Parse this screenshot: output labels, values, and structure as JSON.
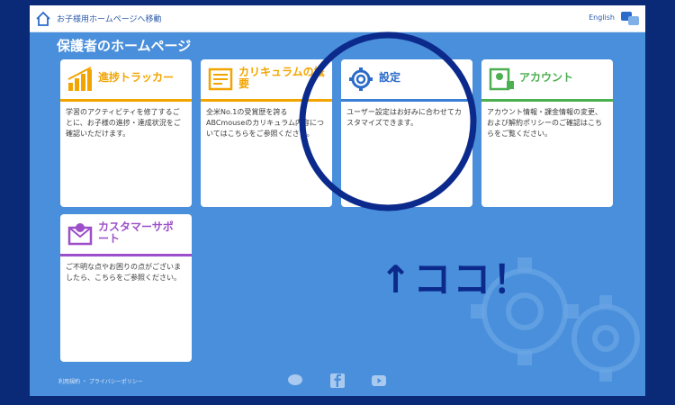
{
  "header": {
    "home_link": "お子様用ホームページへ移動",
    "language": "English"
  },
  "page_title": "保護者のホームページ",
  "cards": [
    {
      "title": "進捗トラッカー",
      "desc": "学習のアクティビティを修了するごとに、お子様の進捗・達成状況をご確認いただけます。",
      "color": "#f2a400"
    },
    {
      "title": "カリキュラムの概要",
      "desc": "全米No.1の受賞歴を誇るABCmouseのカリキュラム内容についてはこちらをご参照ください。",
      "color": "#f2a400"
    },
    {
      "title": "設定",
      "desc": "ユーザー設定はお好みに合わせてカスタマイズできます。",
      "color": "#3a7fd5"
    },
    {
      "title": "アカウント",
      "desc": "アカウント情報・課金情報の変更、および解約ポリシーのご確認はこちらをご覧ください。",
      "color": "#4caf50"
    },
    {
      "title": "カスタマーサポート",
      "desc": "ご不明な点やお困りの点がございましたら、こちらをご参照ください。",
      "color": "#9c4fc9"
    }
  ],
  "footer": {
    "links": "利用規約 ・ プライバシーポリシー"
  },
  "annotation": {
    "text": "↑ココ！",
    "color": "#0b2a8c"
  },
  "icons": {
    "home": "home-icon",
    "language": "language-icon",
    "progress": "bar-chart-icon",
    "curriculum": "document-icon",
    "settings": "gear-icon",
    "account": "account-icon",
    "support": "mail-icon",
    "line": "line-icon",
    "facebook": "facebook-icon",
    "youtube": "youtube-icon"
  }
}
